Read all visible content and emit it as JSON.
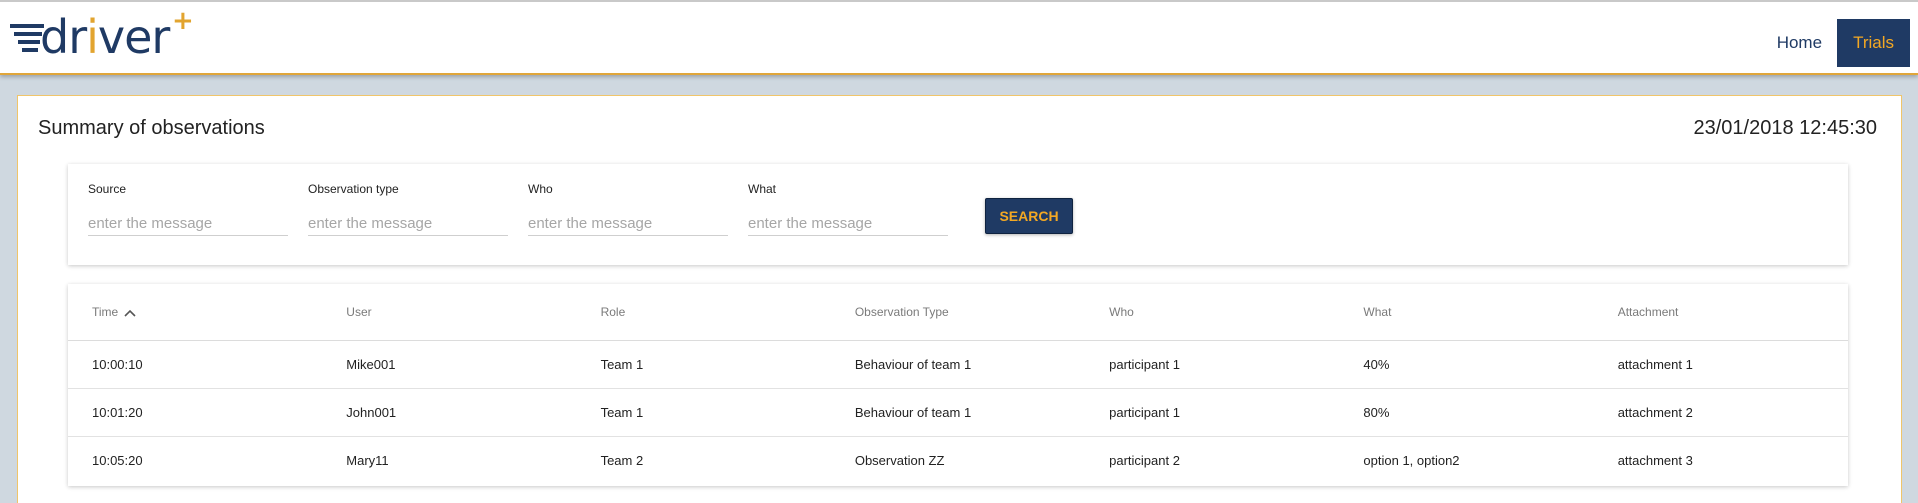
{
  "brand": {
    "name_prefix": "dr",
    "name_i": "i",
    "name_suffix": "ver",
    "plus": "+"
  },
  "nav": {
    "items": [
      {
        "label": "Home",
        "active": false
      },
      {
        "label": "Trials",
        "active": true
      }
    ]
  },
  "page": {
    "title": "Summary of observations",
    "timestamp": "23/01/2018 12:45:30"
  },
  "filters": {
    "fields": [
      {
        "label": "Source",
        "placeholder": "enter the message",
        "value": ""
      },
      {
        "label": "Observation type",
        "placeholder": "enter the message",
        "value": ""
      },
      {
        "label": "Who",
        "placeholder": "enter the message",
        "value": ""
      },
      {
        "label": "What",
        "placeholder": "enter the message",
        "value": ""
      }
    ],
    "search_label": "SEARCH"
  },
  "table": {
    "columns": [
      "Time",
      "User",
      "Role",
      "Observation Type",
      "Who",
      "What",
      "Attachment"
    ],
    "sorted_column": "Time",
    "sort_direction": "ascending",
    "sort_icon": "chevron-up-icon",
    "rows": [
      [
        "10:00:10",
        "Mike001",
        "Team 1",
        "Behaviour of team 1",
        "participant 1",
        "40%",
        "attachment 1"
      ],
      [
        "10:01:20",
        "John001",
        "Team 1",
        "Behaviour of team 1",
        "participant 1",
        "80%",
        "attachment 2"
      ],
      [
        "10:05:20",
        "Mary11",
        "Team 2",
        "Observation ZZ",
        "participant 2",
        "option 1, option2",
        "attachment 3"
      ]
    ]
  },
  "colors": {
    "primary": "#1f3a64",
    "accent": "#f3a823",
    "panel_border": "#f0c56a",
    "background": "#cfd8e0"
  }
}
